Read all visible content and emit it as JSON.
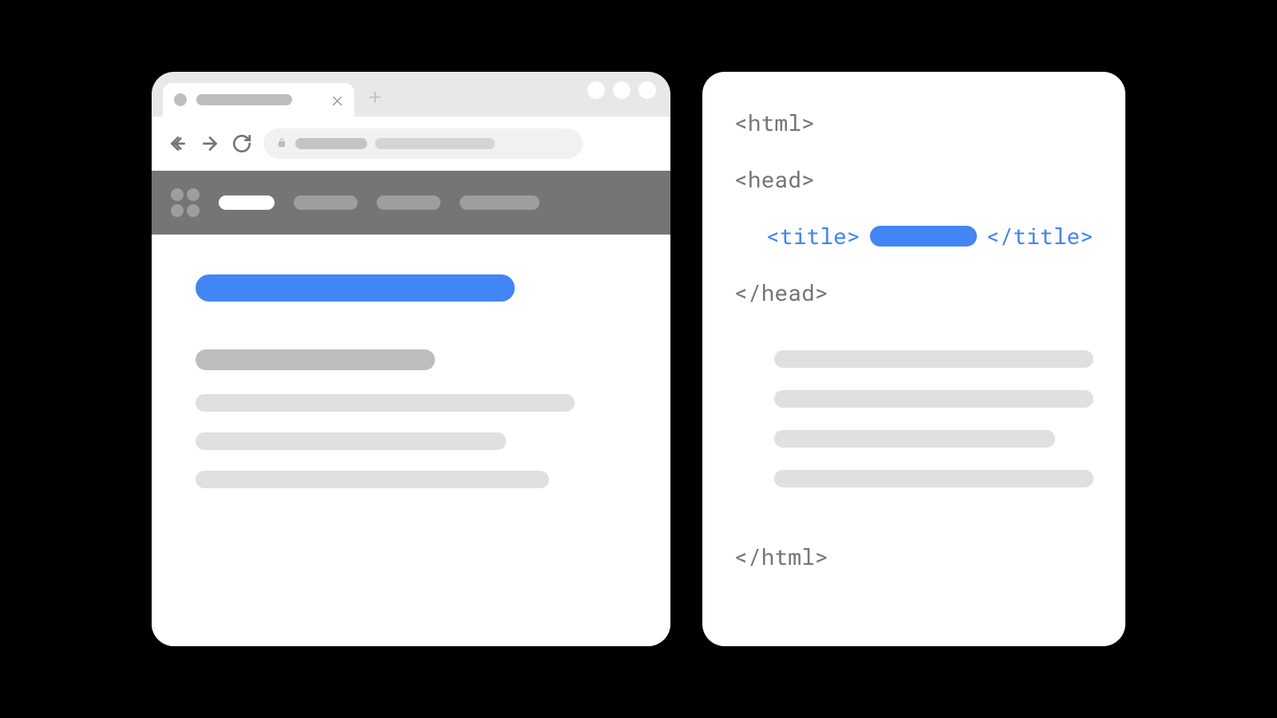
{
  "colors": {
    "accent": "#4285F4",
    "gray_dark": "#757575",
    "gray_mid": "#BDBDBD",
    "gray_light": "#E0E0E0"
  },
  "browser": {
    "tab_close_glyph": "×",
    "new_tab_glyph": "+"
  },
  "code": {
    "lines": {
      "html_open": "<html>",
      "head_open": "<head>",
      "title_open": "<title>",
      "title_close": "</title>",
      "head_close": "</head>",
      "html_close": "</html>"
    }
  }
}
